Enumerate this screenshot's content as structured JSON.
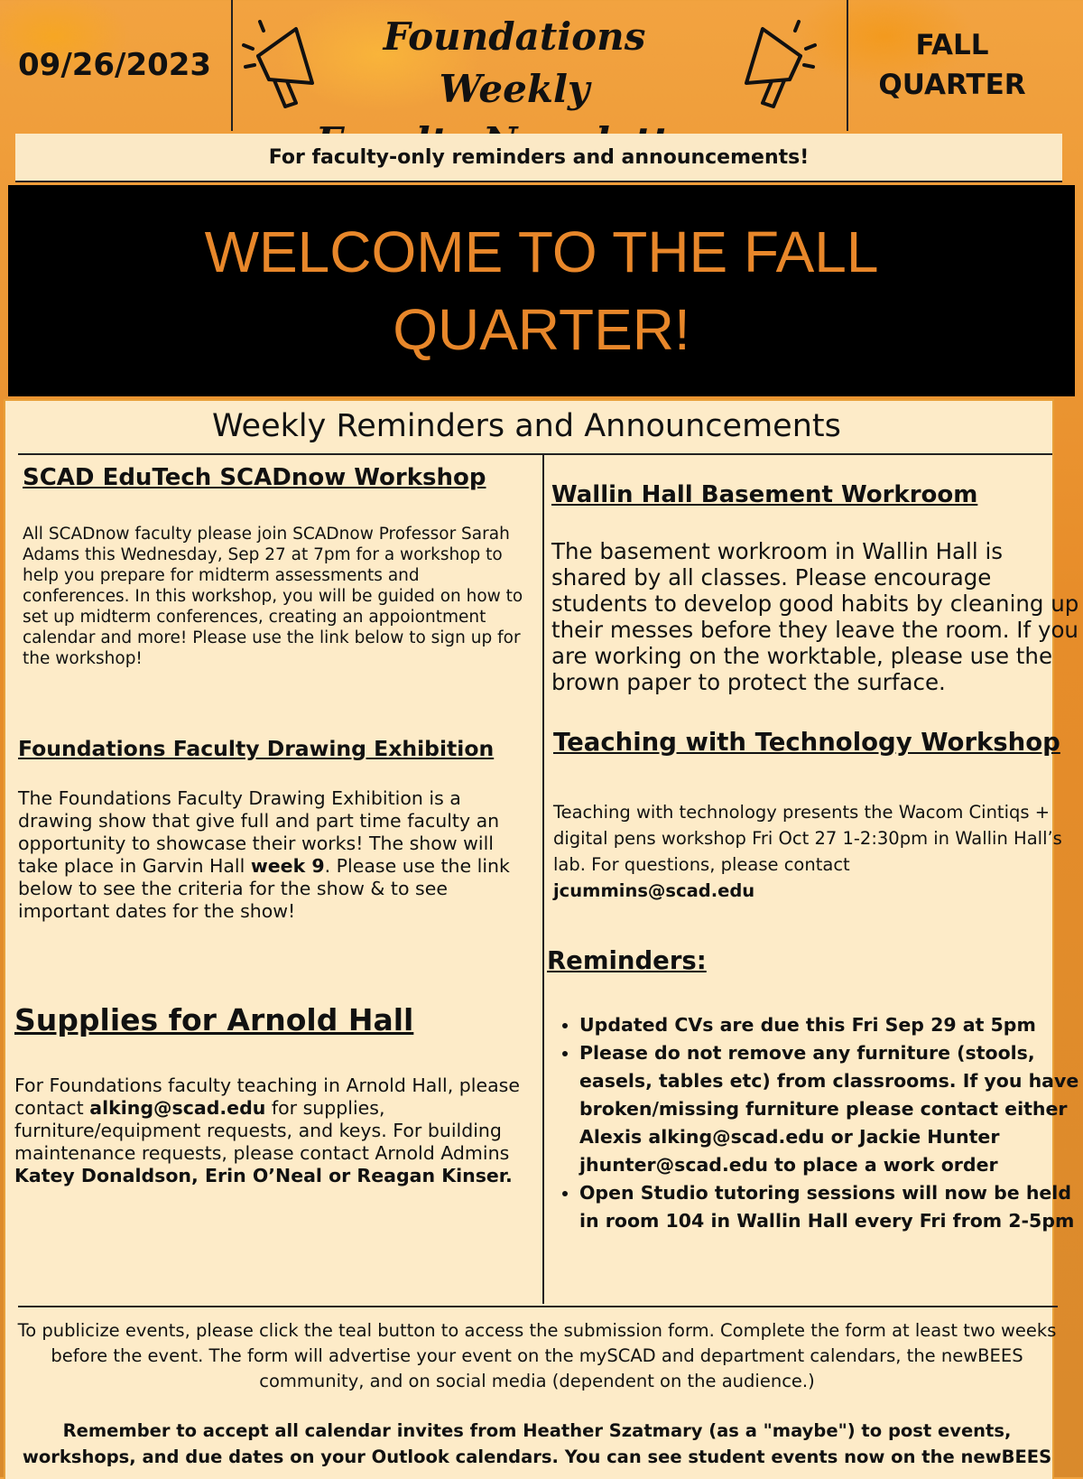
{
  "header": {
    "date": "09/26/2023",
    "title_line1": "Foundations Weekly",
    "title_line2": "Faculty Newsletter",
    "quarter_line1": "FALL",
    "quarter_line2": "QUARTER"
  },
  "subtitle": "For faculty-only reminders and announcements!",
  "welcome": {
    "line1": "WELCOME TO THE FALL",
    "line2": "QUARTER!"
  },
  "section_title": "Weekly Reminders and Announcements",
  "left": {
    "edutech": {
      "heading": "SCAD EduTech SCADnow Workshop",
      "body": "All SCADnow faculty please join SCADnow Professor Sarah Adams this Wednesday, Sep 27 at 7pm for a workshop to help you prepare for midterm assessments and conferences. In this workshop, you will be guided on how to set up midterm conferences, creating  an appoiontment calendar and more! Please use the link below to sign up for the workshop!"
    },
    "exhibition": {
      "heading": "Foundations Faculty Drawing Exhibition",
      "body_before": "The Foundations Faculty Drawing Exhibition is a drawing show that give full and part time faculty an opportunity to showcase their works! The show will take place in Garvin Hall ",
      "body_bold": "week 9",
      "body_after": ". Please use the link below to see the criteria for the show & to see important dates for the show!"
    },
    "supplies": {
      "heading": "Supplies for Arnold Hall",
      "body_1": "For Foundations faculty teaching in Arnold Hall, please contact ",
      "email": "alking@scad.edu",
      "body_2": " for supplies, furniture/equipment requests, and keys. For building maintenance requests, please contact Arnold Admins ",
      "names": "Katey Donaldson, Erin O’Neal or Reagan Kinser."
    }
  },
  "right": {
    "wallin": {
      "heading": "Wallin Hall Basement Workroom",
      "body": "The basement workroom in Wallin Hall is shared by all classes. Please encourage students to develop good habits by cleaning up their messes before they leave the room. If you are working on the worktable, please use the brown paper to protect the surface."
    },
    "tech": {
      "heading": "Teaching with Technology Workshop",
      "body": "Teaching with technology presents the Wacom Cintiqs + digital pens workshop Fri Oct 27 1-2:30pm in Wallin Hall’s lab. For questions, please contact",
      "email": "jcummins@scad.edu"
    },
    "reminders": {
      "heading": "Reminders:",
      "items": [
        "Updated CVs are due this Fri Sep 29 at 5pm",
        "Please do not remove any furniture (stools, easels, tables etc) from classrooms. If you have broken/missing furniture please contact either Alexis alking@scad.edu or Jackie Hunter jhunter@scad.edu to place a work order",
        "Open Studio tutoring sessions will now be held in room 104 in Wallin Hall every Fri from 2-5pm"
      ]
    }
  },
  "footer": {
    "para1": "To publicize events, please click the teal button to access the submission form. Complete the form at least two weeks before the event. The form will advertise your event on the mySCAD and department calendars, the newBEES community, and on social media (dependent on the audience.)",
    "para2": "Remember to accept all calendar invites from Heather Szatmary (as a \"maybe\") to post events, workshops, and due dates on your Outlook calendars. You can see student events now on the newBEES"
  }
}
